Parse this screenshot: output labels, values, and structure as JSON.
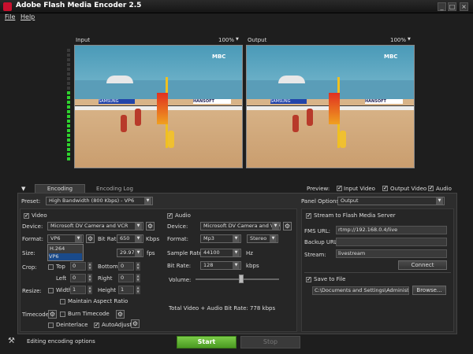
{
  "window": {
    "title": "Adobe Flash Media Encoder 2.5",
    "minimize": "_",
    "maximize": "□",
    "close": "×"
  },
  "menu": {
    "file": "File",
    "help": "Help"
  },
  "video": {
    "input_label": "Input",
    "input_zoom": "100%",
    "output_label": "Output",
    "output_zoom": "100%",
    "overlay_logo": "MBC",
    "banner1": "HANSOFT",
    "banner2": "SAMSUNG"
  },
  "tabs": {
    "encoding_options": "Encoding Options",
    "encoding_log": "Encoding Log"
  },
  "preview": {
    "label": "Preview:",
    "input_video": "Input Video",
    "output_video": "Output Video",
    "audio": "Audio"
  },
  "preset": {
    "label": "Preset:",
    "value": "High Bandwidth (800 Kbps) - VP6"
  },
  "panel_options": {
    "label": "Panel Options:",
    "value": "Output"
  },
  "video_section": {
    "label": "Video",
    "device_label": "Device:",
    "device": "Microsoft DV Camera and VCR",
    "format_label": "Format:",
    "format": "VP6",
    "format_options": [
      "H.264",
      "VP6"
    ],
    "bitrate_label": "Bit Rate",
    "bitrate": "650",
    "bitrate_unit": "Kbps",
    "size_label": "Size:",
    "fps": "29.97",
    "fps_unit": "fps",
    "crop_label": "Crop:",
    "top": "Top",
    "bottom": "Bottom",
    "left": "Left",
    "right": "Right",
    "top_val": "0",
    "bottom_val": "0",
    "left_val": "0",
    "right_val": "0",
    "resize_label": "Resize:",
    "width": "Width",
    "height": "Height",
    "width_val": "1",
    "height_val": "1",
    "aspect": "Maintain Aspect Ratio",
    "timecode_label": "Timecode:",
    "burn_timecode": "Burn Timecode",
    "deinterlace": "Deinterlace",
    "autoadjust": "AutoAdjust"
  },
  "audio_section": {
    "label": "Audio",
    "device_label": "Device:",
    "device": "Microsoft DV Camera and VCR",
    "format_label": "Format:",
    "format": "Mp3",
    "channels": "Stereo",
    "sample_rate_label": "Sample Rate:",
    "sample_rate": "44100",
    "sample_unit": "Hz",
    "bitrate_label": "Bit Rate:",
    "bitrate": "128",
    "bitrate_unit": "kbps",
    "volume_label": "Volume:",
    "volume_level": 0.55,
    "total_bitrate": "Total Video + Audio Bit Rate: 778 kbps"
  },
  "stream": {
    "label": "Stream to Flash Media Server",
    "fms_url_label": "FMS URL:",
    "fms_url": "rtmp://192.168.0.4/live",
    "backup_url_label": "Backup URL:",
    "backup_url": "",
    "stream_label": "Stream:",
    "stream": "livestream",
    "connect": "Connect"
  },
  "save": {
    "label": "Save to File",
    "path": "C:\\Documents and Settings\\Administrat",
    "browse": "Browse..."
  },
  "status": {
    "text": "Editing encoding options"
  },
  "actions": {
    "start": "Start",
    "stop": "Stop"
  },
  "colors": {
    "start_green": "#5fae32",
    "meter_green": "#2fd22f"
  }
}
